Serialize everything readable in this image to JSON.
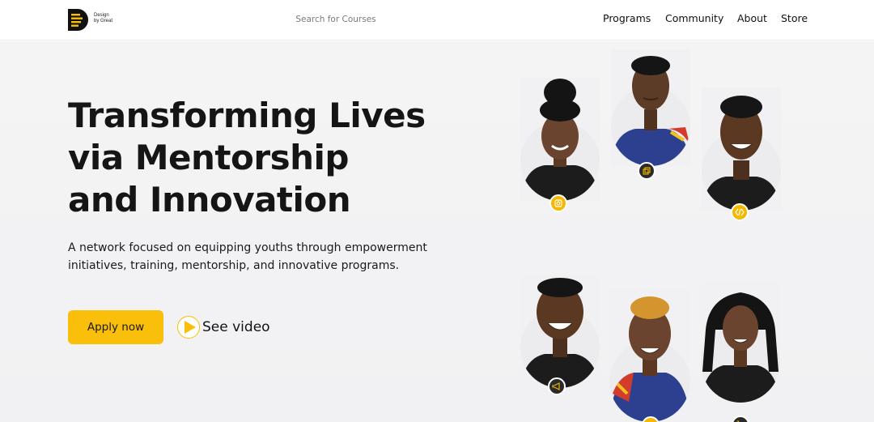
{
  "header": {
    "logo_text_line1": "Design",
    "logo_text_line2": "by Great",
    "search_placeholder": "Search for Courses",
    "nav": [
      "Programs",
      "Community",
      "About",
      "Store"
    ]
  },
  "hero": {
    "title_lines": [
      "Transforming Lives",
      "via Mentorship",
      "and Innovation"
    ],
    "subtitle": "A network focused on equipping youths through empowerment initiatives, training, mentorship, and innovative programs.",
    "apply_label": "Apply now",
    "video_label": "See video"
  },
  "colors": {
    "accent": "#f9bf0b",
    "hero_bg": "#f3f3f4",
    "badge_dark": "#2a2a2a"
  },
  "portraits": [
    {
      "name": "portrait-1",
      "badge_icon": "camera-icon",
      "badge_style": "yellow"
    },
    {
      "name": "portrait-2",
      "badge_icon": "gallery-icon",
      "badge_style": "dark"
    },
    {
      "name": "portrait-3",
      "badge_icon": "code-icon",
      "badge_style": "yellow"
    },
    {
      "name": "portrait-4",
      "badge_icon": "megaphone-icon",
      "badge_style": "dark"
    },
    {
      "name": "portrait-5",
      "badge_icon": "none",
      "badge_style": "yellow"
    },
    {
      "name": "portrait-6",
      "badge_icon": "cart-icon",
      "badge_style": "dark"
    }
  ]
}
